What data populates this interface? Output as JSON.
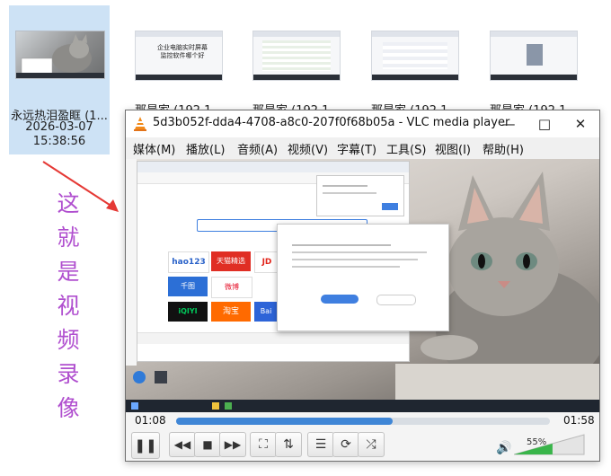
{
  "explorer": {
    "files": [
      {
        "name": "永远热泪盈眶 (1...",
        "date": "2026-03-07",
        "time": "15:38:56",
        "selected": true
      },
      {
        "name": "那是家 (192.1...",
        "selected": false
      },
      {
        "name": "那是家 (192.1...",
        "selected": false
      },
      {
        "name": "那是家 (192.1...",
        "selected": false
      },
      {
        "name": "那是家 (192.1...",
        "selected": false
      }
    ],
    "thumb2_text": "企业电脑实时屏幕监控软件哪个好"
  },
  "annotation": {
    "text": "这就是视频录像",
    "color": "#b04fcf"
  },
  "vlc": {
    "title": "5d3b052f-dda4-4708-a8c0-207f0f68b05a - VLC media player",
    "menu": [
      "媒体(M)",
      "播放(L)",
      "音频(A)",
      "视频(V)",
      "字幕(T)",
      "工具(S)",
      "视图(I)",
      "帮助(H)"
    ],
    "elapsed": "01:08",
    "duration": "01:58",
    "progress": 0.58,
    "volume_label": "55%",
    "volume": 0.55,
    "accent": "#3f86d6",
    "volume_color": "#39b54a",
    "screen_logos": [
      "hao123",
      "天猫精选",
      "JD",
      "千图",
      "微博",
      "淘宝",
      "iQIYI",
      "Bai"
    ]
  }
}
